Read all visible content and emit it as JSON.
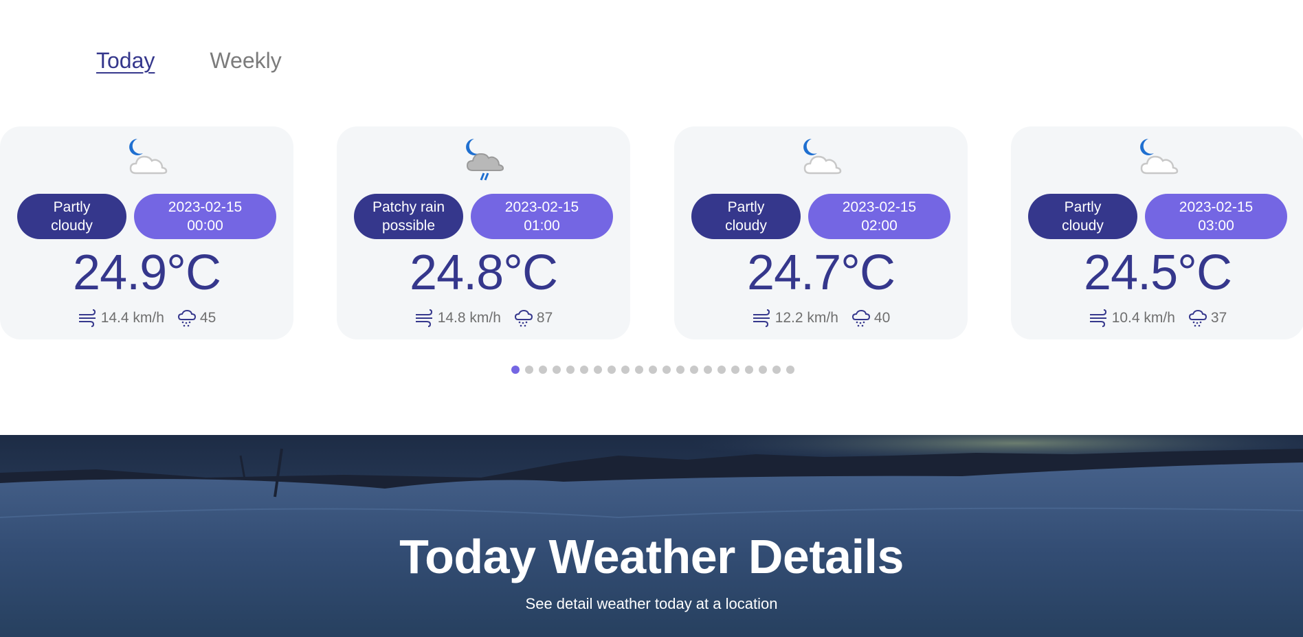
{
  "tabs": [
    {
      "label": "Today",
      "active": true
    },
    {
      "label": "Weekly",
      "active": false
    }
  ],
  "hourly": [
    {
      "icon": "partly-cloudy-night-icon",
      "condition_line1": "Partly",
      "condition_line2": "cloudy",
      "date": "2023-02-15",
      "time": "00:00",
      "temp": "24.9°C",
      "wind": "14.4 km/h",
      "humidity": "45"
    },
    {
      "icon": "patchy-rain-night-icon",
      "condition_line1": "Patchy rain",
      "condition_line2": "possible",
      "date": "2023-02-15",
      "time": "01:00",
      "temp": "24.8°C",
      "wind": "14.8 km/h",
      "humidity": "87"
    },
    {
      "icon": "partly-cloudy-night-icon",
      "condition_line1": "Partly",
      "condition_line2": "cloudy",
      "date": "2023-02-15",
      "time": "02:00",
      "temp": "24.7°C",
      "wind": "12.2 km/h",
      "humidity": "40"
    },
    {
      "icon": "partly-cloudy-night-icon",
      "condition_line1": "Partly",
      "condition_line2": "cloudy",
      "date": "2023-02-15",
      "time": "03:00",
      "temp": "24.5°C",
      "wind": "10.4 km/h",
      "humidity": "37"
    }
  ],
  "pagination": {
    "total": 21,
    "active_index": 0
  },
  "hero": {
    "title": "Today Weather Details",
    "subtitle": "See detail weather today at a location"
  },
  "colors": {
    "primary": "#35378c",
    "accent": "#7466e3",
    "card_bg": "#f4f6f8",
    "icon_blue": "#1f6fd0"
  }
}
